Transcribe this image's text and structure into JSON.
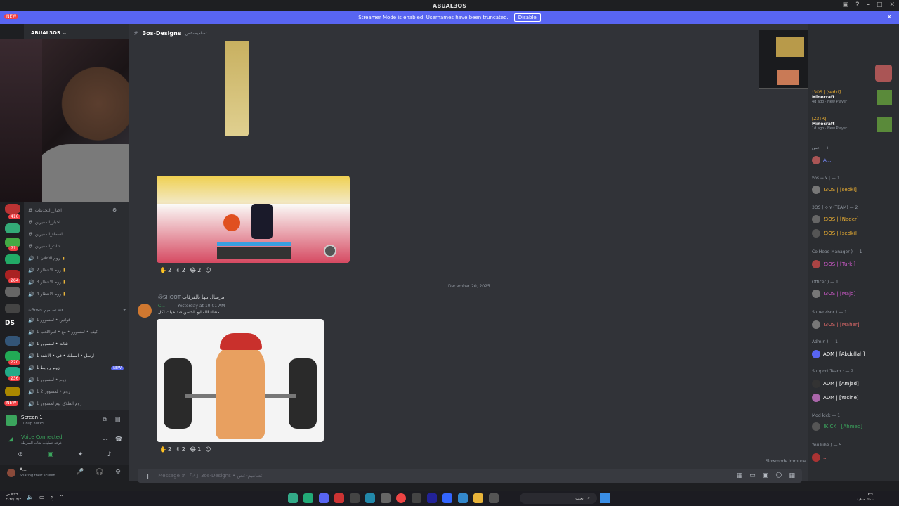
{
  "window": {
    "title": "ABUAL3OS"
  },
  "banner": {
    "text": "Streamer Mode is enabled. Usernames have been truncated.",
    "button": "Disable"
  },
  "server": {
    "name": "ABUAL3OS"
  },
  "channel": {
    "name": "3os-Designs",
    "suffix": "تصاميم-عص"
  },
  "server_badges": [
    "NEW",
    "416",
    "71",
    "264",
    "220",
    "236",
    "NEW"
  ],
  "server_letters": {
    "ds": "DS"
  },
  "channels": [
    {
      "name": "اخبار_التحديثات",
      "type": "text"
    },
    {
      "name": "اخبار_المقيرين",
      "type": "text"
    },
    {
      "name": "اسماء_المقيرين",
      "type": "text"
    },
    {
      "name": "شات_المقيرين",
      "type": "text"
    },
    {
      "name": "روم الاعلان 1",
      "type": "voice"
    },
    {
      "name": "روم الانتظار 2",
      "type": "voice"
    },
    {
      "name": "روم الانتظار 3",
      "type": "voice"
    },
    {
      "name": "روم الانتظار 4",
      "type": "voice"
    }
  ],
  "category": "~3os~ فئة تصاميم",
  "voice_channels": [
    {
      "name": "قوانين • لمسوور 1"
    },
    {
      "name": "كيف • لمسوور • مع • انبراللعب 1"
    },
    {
      "name": "شات • لمسوور 1"
    },
    {
      "name": "ارسل • اسملك • في • الاشنة 1"
    },
    {
      "name": "زوم_روابط 1",
      "new": "NEW"
    },
    {
      "name": "زوم • لمسوور 1"
    },
    {
      "name": "زوم • لمسوور 2 1"
    },
    {
      "name": "زوم انطلاق ليم لمسوور 1"
    }
  ],
  "voice_panel": {
    "screen": "Screen 1",
    "screen_sub": "1080p 30FPS",
    "status": "Voice Connected",
    "status_sub": "غرفة عمليات شات الشرطة"
  },
  "user_panel": {
    "name": "A...",
    "status": "Sharing their screen"
  },
  "messages": {
    "reactions1": [
      {
        "emoji": "✋",
        "count": "2"
      },
      {
        "emoji": "✌",
        "count": "2"
      },
      {
        "emoji": "😂",
        "count": "2"
      }
    ],
    "date_divider": "December 20, 2025",
    "reply_label": "@SHOOT",
    "reply_text": "مرسال بيها بالفرقات",
    "author": "C...",
    "timestamp": "Yesterday at 10:01 AM",
    "text": "مشاء الله ابو الحسن شد حيلك لكل",
    "reactions2": [
      {
        "emoji": "✋",
        "count": "2"
      },
      {
        "emoji": "✌",
        "count": "2"
      },
      {
        "emoji": "😂",
        "count": "1"
      }
    ]
  },
  "input": {
    "placeholder": "Message # 「✓」3os-Designs • تصاميم-عص"
  },
  "slowmode": "Slowmode immune",
  "members": {
    "top_items": [
      {
        "name": "!3OS | [sedki]",
        "game": "Minecraft",
        "meta": "4d ago · New Player"
      },
      {
        "name": "[Z3TR]",
        "game": "Minecraft",
        "meta": "1d ago · New Player"
      }
    ],
    "groups": [
      {
        "header": "١ — عص",
        "members": [
          "A..."
        ]
      },
      {
        "header": "۳os ⊹ ۷ | — 1",
        "members": [
          "!3OS | [sedki]"
        ]
      },
      {
        "header": "3OS | ⊹ ۷ (TEAM) — 2",
        "members": [
          "!3OS | [Nader]",
          "!3OS | [sedki]"
        ]
      },
      {
        "header": "Co Head Manager ) — 1",
        "members": [
          "!3OS | [Turki]"
        ]
      },
      {
        "header": "Officer ) — 1",
        "members": [
          "!3OS | [Majd]"
        ]
      },
      {
        "header": "Supervisor ) — 1",
        "members": [
          "!3OS | [Maher]"
        ]
      },
      {
        "header": "Admin ) — 1",
        "members": [
          "ADM | [Abdullah]"
        ]
      },
      {
        "header": "Support Team : — 2",
        "members": [
          "ADM | [Amjad]",
          "ADM | [Yacine]"
        ]
      },
      {
        "header": "Mod kick — 1",
        "members": [
          "!KICK | [Ahmed]"
        ]
      },
      {
        "header": "YouTube ) — 5",
        "members": [
          "..."
        ]
      }
    ]
  },
  "taskbar": {
    "temp": "6°C",
    "weather": "سماء صافية",
    "time": "٧:٢٦ ص",
    "date": "٢٠٢٥/١٢/٢١",
    "search": "بحث",
    "lang": "ع"
  }
}
